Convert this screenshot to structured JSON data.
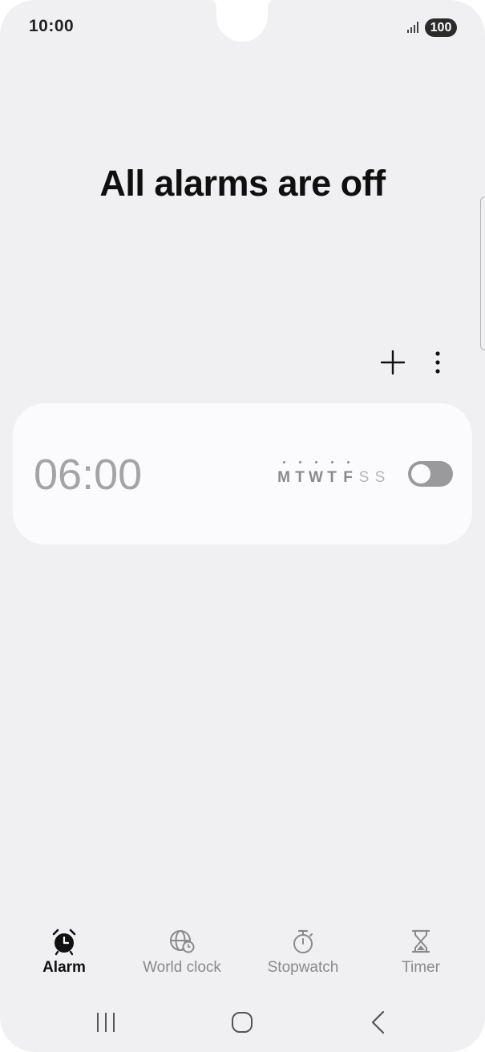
{
  "status_bar": {
    "time": "10:00",
    "battery": "100",
    "signal_icon": "signal-icon"
  },
  "main": {
    "title": "All alarms are off",
    "add_icon": "plus-icon",
    "more_icon": "more-vertical-icon"
  },
  "alarm": {
    "time": "06:00",
    "enabled": false,
    "days": [
      {
        "letter": "M",
        "active": true
      },
      {
        "letter": "T",
        "active": true
      },
      {
        "letter": "W",
        "active": true
      },
      {
        "letter": "T",
        "active": true
      },
      {
        "letter": "F",
        "active": true
      },
      {
        "letter": "S",
        "active": false
      },
      {
        "letter": "S",
        "active": false
      }
    ]
  },
  "tabs": [
    {
      "label": "Alarm",
      "icon": "alarm-clock-icon",
      "active": true
    },
    {
      "label": "World clock",
      "icon": "globe-clock-icon",
      "active": false
    },
    {
      "label": "Stopwatch",
      "icon": "stopwatch-icon",
      "active": false
    },
    {
      "label": "Timer",
      "icon": "hourglass-icon",
      "active": false
    }
  ],
  "nav": {
    "recents_icon": "recents-icon",
    "home_icon": "home-icon",
    "back_icon": "back-icon"
  },
  "colors": {
    "background": "#f0f0f2",
    "card": "#fbfbfd",
    "inactive_text": "#a4a4a7",
    "toggle_off": "#9a9a9d"
  }
}
